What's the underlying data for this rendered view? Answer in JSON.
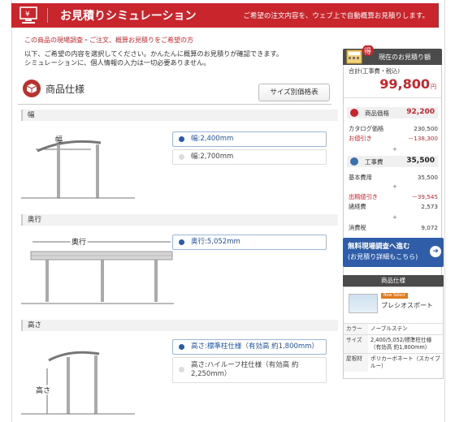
{
  "header": {
    "title": "お見積りシミュレーション",
    "notice": "ご希望の注文内容を、ウェブ上で自動概算お見積りします。"
  },
  "subtitle": "この商品の現場調査・ご注文、概算お見積りをご希望の方",
  "intro": [
    "以下、ご希望の内容を選択してください。かんたんに概算のお見積りが確認できます。",
    "シミュレーションに、個人情報の入力は一切必要ありません。"
  ],
  "spec": {
    "title": "商品仕様",
    "size_button": "サイズ別価格表"
  },
  "sections": {
    "width": {
      "label": "幅",
      "figure_label": "幅",
      "options": [
        {
          "label": "幅:2,400mm",
          "selected": true
        },
        {
          "label": "幅:2,700mm",
          "selected": false
        }
      ]
    },
    "depth": {
      "label": "奥行",
      "figure_label": "奥行",
      "options": [
        {
          "label": "奥行:5,052mm",
          "selected": true
        }
      ]
    },
    "height": {
      "label": "高さ",
      "figure_label": "高さ",
      "options": [
        {
          "label": "高さ:標準柱仕様（有効高 約1,800mm）",
          "selected": true
        },
        {
          "label": "高さ:ハイルーフ柱仕様（有効高 約2,250mm）",
          "selected": false
        }
      ]
    }
  },
  "estimate": {
    "header": "現在のお見積り額",
    "badge": "得",
    "total_label": "合計(工事費・税込)",
    "total_value": "99,800",
    "yen": "円",
    "product_price_label": "商品価格",
    "product_price": "92,200",
    "catalog_label": "カタログ価格",
    "catalog_value": "230,500",
    "discount_label": "お値引き",
    "discount_value": "－138,300",
    "construction_label": "工事費",
    "construction_value": "35,500",
    "base_fee_label": "基本費用",
    "base_fee_value": "35,500",
    "visit_discount_label": "出精値引き",
    "visit_discount_value": "－39,545",
    "misc_label": "諸経費",
    "misc_value": "2,573",
    "tax_label": "消費税",
    "tax_value": "9,072",
    "plus": "+"
  },
  "cta": {
    "line1": "無料現場調査へ進む",
    "line2": "(お見積り詳細もこちら)",
    "arrow": "➜"
  },
  "product_info": {
    "header": "商品仕様",
    "badge": "Now Select",
    "name": "プレシオスポート",
    "rows": [
      {
        "key": "カラー",
        "value": "ノーブルステン"
      },
      {
        "key": "サイズ",
        "value": "2,400/5,052/標準柱仕様（有効高 約1,800mm）"
      },
      {
        "key": "屋根材",
        "value": "ポリカーボネート（スカイブルー）"
      }
    ]
  },
  "colors": {
    "brand": "#c9252c",
    "accent_blue": "#2f5da8",
    "dark": "#4b4b4b"
  },
  "icons": [
    "computer-icon",
    "cube-icon",
    "calculator-icon",
    "wrench-icon",
    "arrow-right-icon"
  ]
}
